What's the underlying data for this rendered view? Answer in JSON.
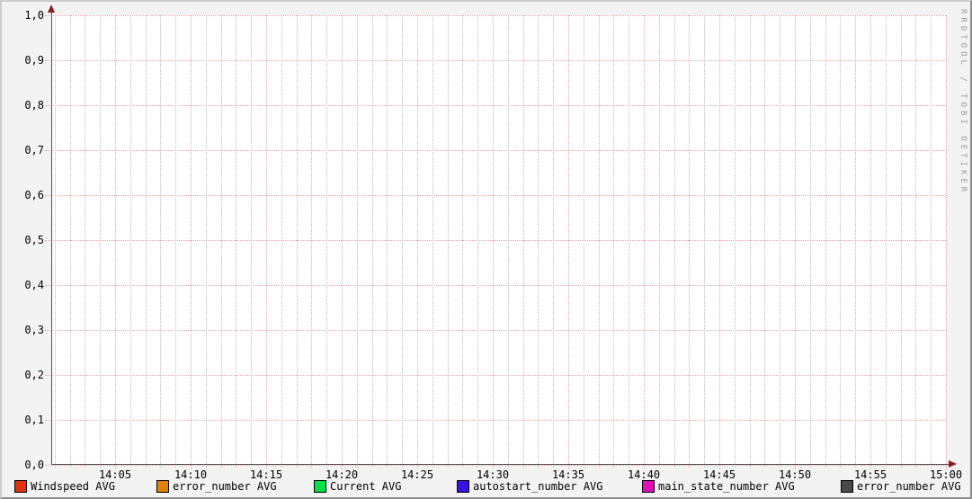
{
  "watermark": "RRDTOOL / TOBI OETIKER",
  "chart_data": {
    "type": "line",
    "title": "",
    "xlabel": "",
    "ylabel": "",
    "x_ticks": [
      "14:05",
      "14:10",
      "14:15",
      "14:20",
      "14:25",
      "14:30",
      "14:35",
      "14:40",
      "14:45",
      "14:50",
      "14:55",
      "15:00"
    ],
    "y_ticks": [
      "1,0",
      "0,9",
      "0,8",
      "0,7",
      "0,6",
      "0,5",
      "0,4",
      "0,3",
      "0,2",
      "0,1",
      "0,0"
    ],
    "ylim": [
      0.0,
      1.0
    ],
    "grid": "on",
    "legend_position": "bottom",
    "series": [
      {
        "name": "Windspeed AVG",
        "color": "#E2330C",
        "values": []
      },
      {
        "name": "error_number AVG",
        "color": "#E08200",
        "values": []
      },
      {
        "name": "Current AVG",
        "color": "#00E04C",
        "values": []
      },
      {
        "name": "autostart_number AVG",
        "color": "#3A12E0",
        "values": []
      },
      {
        "name": "main_state_number AVG",
        "color": "#E00EB8",
        "values": []
      },
      {
        "name": "error_number AVG",
        "color": "#4A4A4A",
        "values": []
      }
    ]
  }
}
